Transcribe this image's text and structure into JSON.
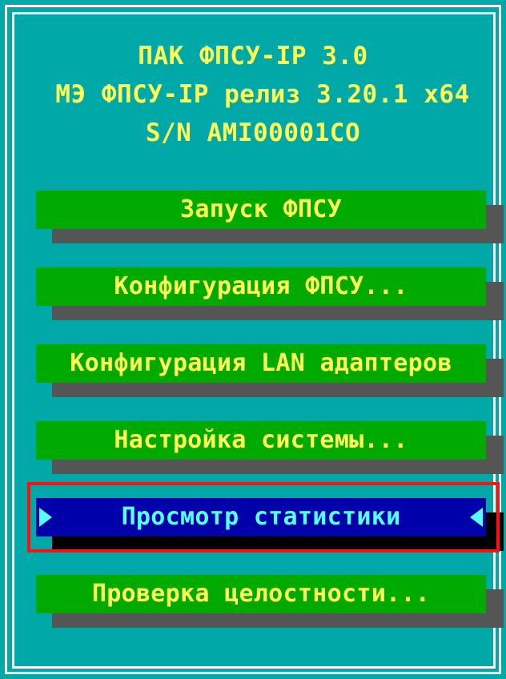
{
  "header": {
    "line1": "ПАК ФПСУ-IP 3.0",
    "line2": "МЭ ФПСУ-IP релиз 3.20.1 x64",
    "line3": "S/N AMI00001CO"
  },
  "menu": {
    "items": [
      {
        "label": "Запуск ФПСУ",
        "selected": false
      },
      {
        "label": "Конфигурация ФПСУ...",
        "selected": false
      },
      {
        "label": "Конфигурация LAN адаптеров",
        "selected": false
      },
      {
        "label": "Настройка системы...",
        "selected": false
      },
      {
        "label": "Просмотр статистики",
        "selected": true
      },
      {
        "label": "Проверка целостности...",
        "selected": false
      }
    ]
  },
  "colors": {
    "background": "#00a8a8",
    "button": "#00aa00",
    "button_text": "#ffff55",
    "selected_button": "#0000aa",
    "selected_text": "#55ffff",
    "shadow": "#555555",
    "highlight": "#ff1010"
  }
}
